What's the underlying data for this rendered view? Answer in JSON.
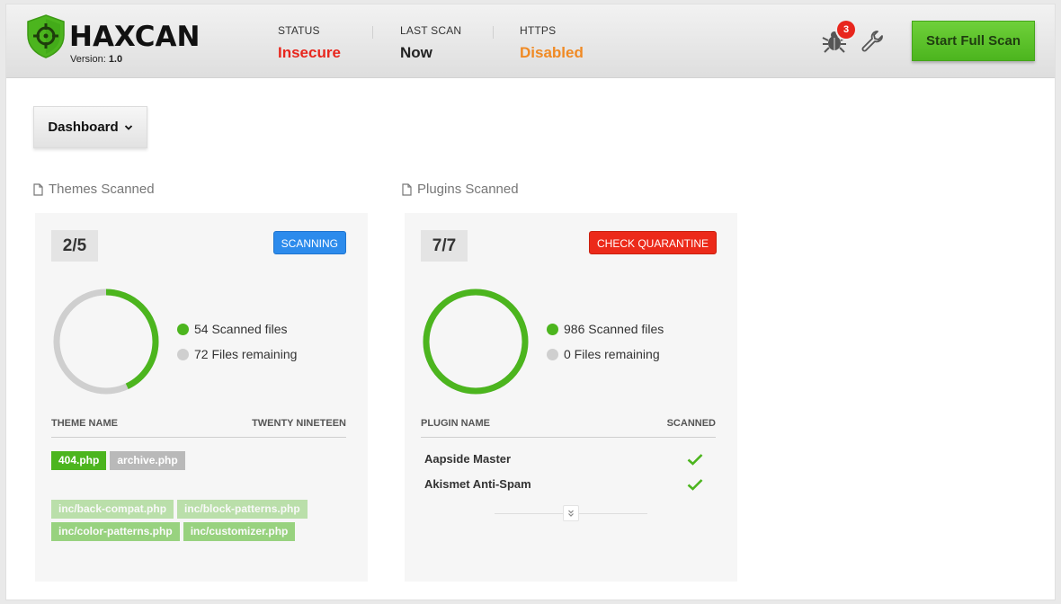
{
  "header": {
    "brand": "HAXCAN",
    "version_label": "Version:",
    "version_value": "1.0",
    "stats": [
      {
        "label": "STATUS",
        "value": "Insecure",
        "color": "#e8261d"
      },
      {
        "label": "LAST SCAN",
        "value": "Now",
        "color": "#222222"
      },
      {
        "label": "HTTPS",
        "value": "Disabled",
        "color": "#f08a24"
      }
    ],
    "threat_count": "3",
    "icons": [
      "shield-crosshair-icon",
      "bug-icon",
      "wrench-icon"
    ],
    "scan_button": "Start Full Scan"
  },
  "toolbar": {
    "dashboard_label": "Dashboard"
  },
  "themes": {
    "section_title": "Themes Scanned",
    "count": "2/5",
    "status_pill": "SCANNING",
    "progress_fraction": 0.43,
    "legend_scanned": "54 Scanned files",
    "legend_remaining": "72 Files remaining",
    "col_name": "THEME NAME",
    "col_value": "TWENTY NINETEEN",
    "files_row1": [
      "404.php",
      "archive.php"
    ],
    "files_row2": [
      "inc/back-compat.php",
      "inc/block-patterns.php"
    ],
    "files_row3": [
      "inc/color-patterns.php",
      "inc/customizer.php"
    ]
  },
  "plugins": {
    "section_title": "Plugins Scanned",
    "count": "7/7",
    "status_pill": "CHECK QUARANTINE",
    "progress_fraction": 1.0,
    "legend_scanned": "986 Scanned files",
    "legend_remaining": "0 Files remaining",
    "col_name": "PLUGIN NAME",
    "col_value": "SCANNED",
    "rows": [
      {
        "name": "Aapside Master",
        "scanned": true
      },
      {
        "name": "Akismet Anti-Spam",
        "scanned": true
      }
    ]
  },
  "colors": {
    "accent_green": "#4cb51e",
    "ring_grey": "#cfcfcf",
    "scanning_blue": "#2c8bec",
    "quarantine_red": "#ec2a1a"
  }
}
